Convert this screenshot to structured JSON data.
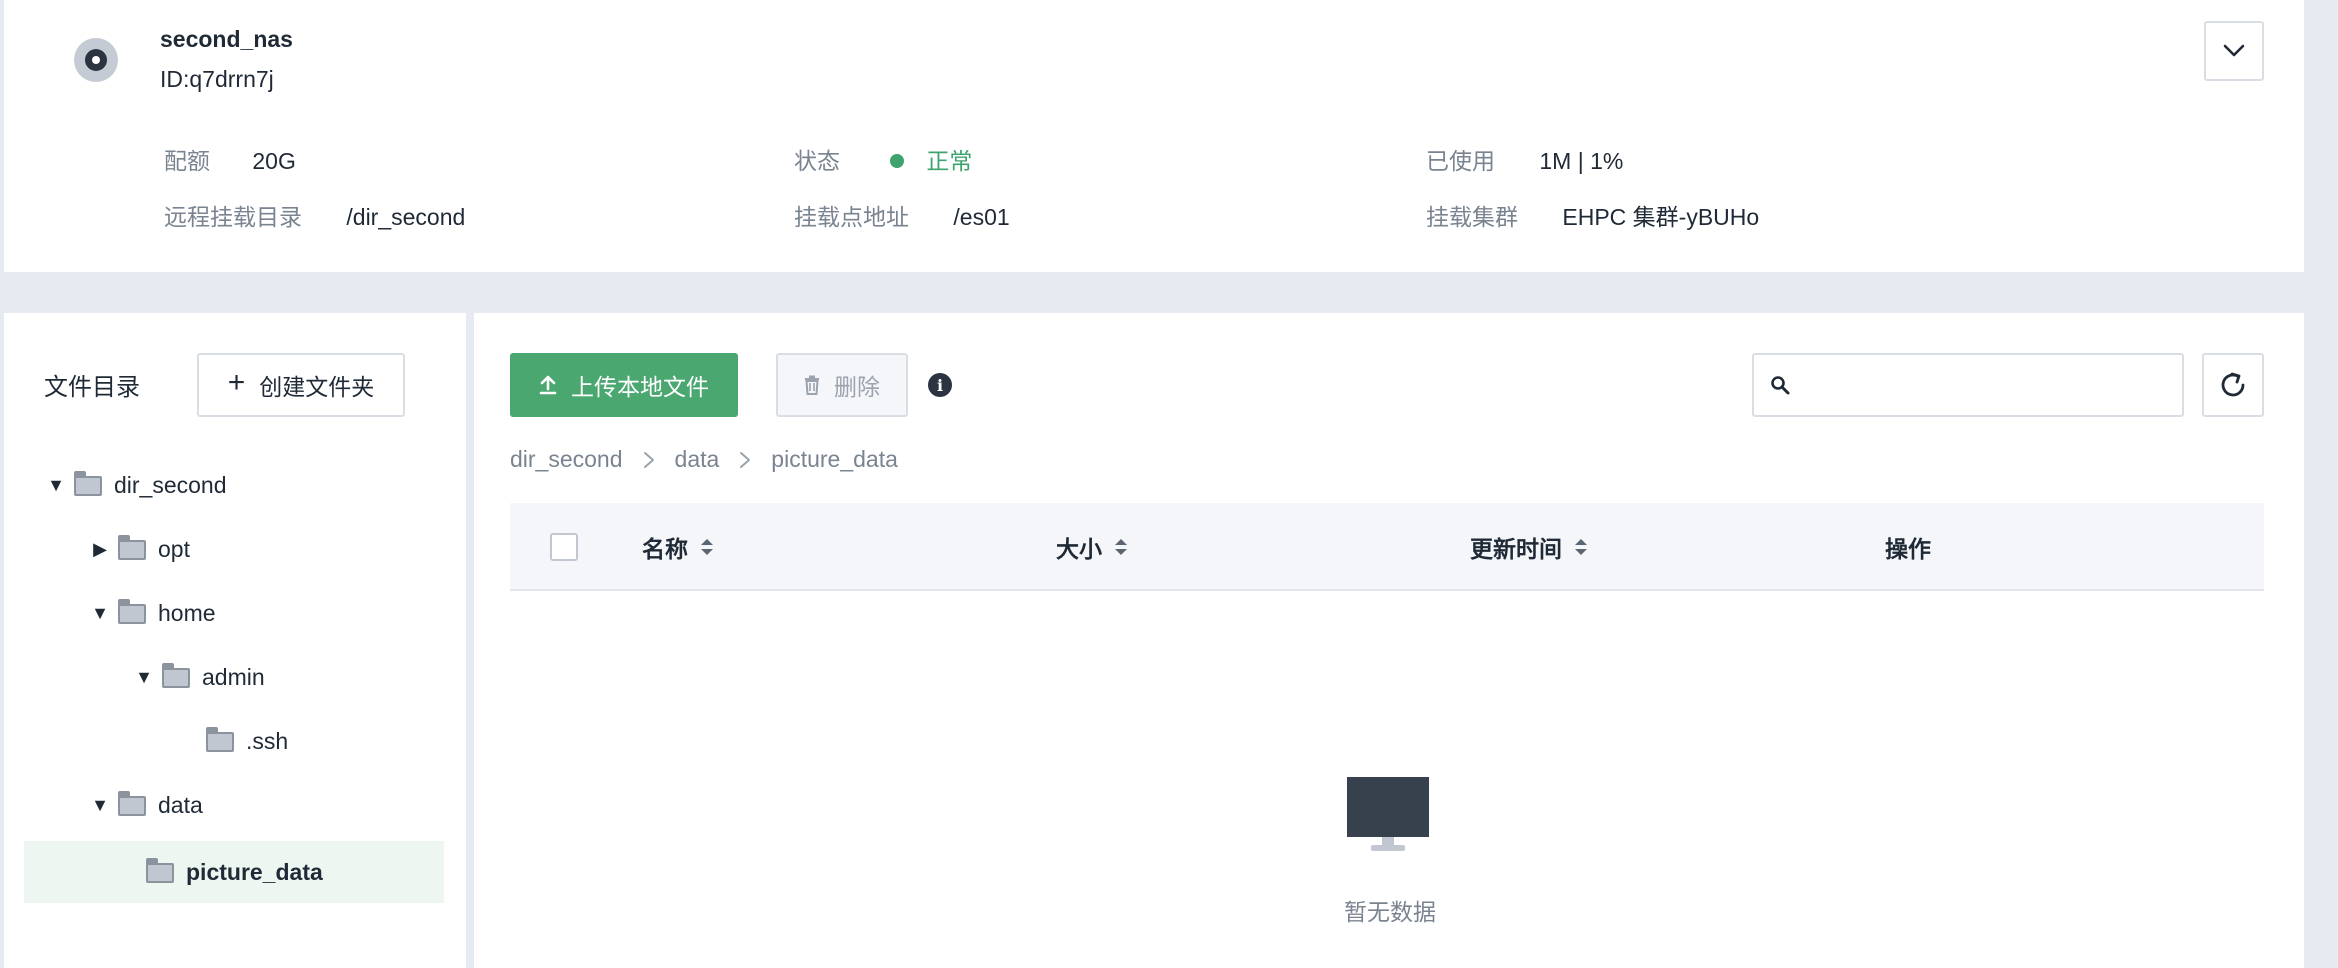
{
  "nas": {
    "name": "second_nas",
    "id": "ID:q7drrn7j",
    "fields": {
      "quota_label": "配额",
      "quota_value": "20G",
      "status_label": "状态",
      "status_value": "正常",
      "used_label": "已使用",
      "used_value": "1M | 1%",
      "remote_dir_label": "远程挂载目录",
      "remote_dir_value": "/dir_second",
      "mount_addr_label": "挂载点地址",
      "mount_addr_value": "/es01",
      "cluster_label": "挂载集群",
      "cluster_value": "EHPC 集群-yBUHo"
    }
  },
  "tree": {
    "title": "文件目录",
    "create_folder_label": "创建文件夹",
    "items": [
      {
        "label": "dir_second",
        "expanded": true
      },
      {
        "label": "opt",
        "expanded": false
      },
      {
        "label": "home",
        "expanded": true
      },
      {
        "label": "admin",
        "expanded": true
      },
      {
        "label": ".ssh"
      },
      {
        "label": "data",
        "expanded": true
      },
      {
        "label": "picture_data",
        "selected": true
      }
    ]
  },
  "toolbar": {
    "upload_label": "上传本地文件",
    "delete_label": "删除",
    "search_placeholder": ""
  },
  "breadcrumb": [
    "dir_second",
    "data",
    "picture_data"
  ],
  "table": {
    "columns": [
      "名称",
      "大小",
      "更新时间",
      "操作"
    ],
    "empty_text": "暂无数据"
  },
  "colors": {
    "accent": "#4aa770",
    "status_ok": "#3ea36c",
    "background": "#e6ebf2"
  }
}
